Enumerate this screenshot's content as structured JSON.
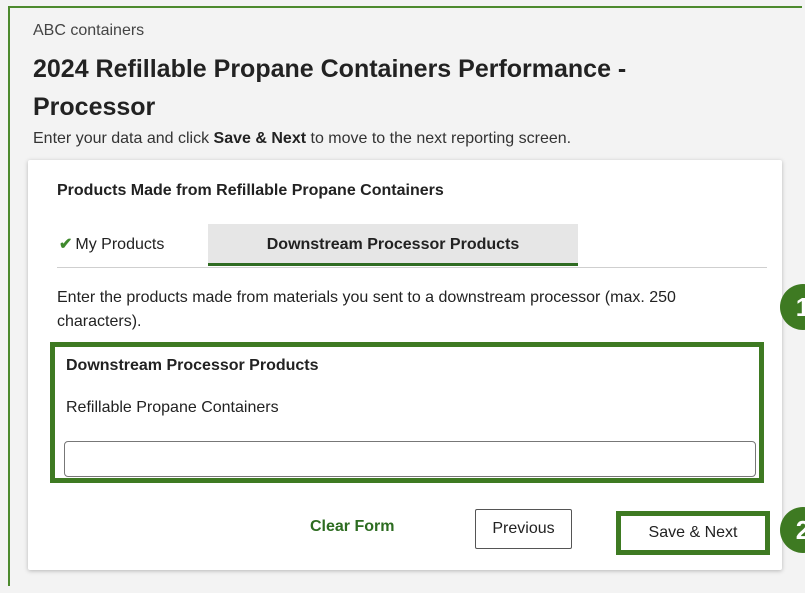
{
  "header": {
    "organization": "ABC containers",
    "title": "2024 Refillable Propane Containers Performance - Processor",
    "instruction_prefix": "Enter your data and click ",
    "instruction_bold": "Save & Next",
    "instruction_suffix": " to move to the next reporting screen."
  },
  "card": {
    "section_title": "Products Made from Refillable Propane Containers",
    "tabs": [
      {
        "label": "My Products",
        "completed": true
      },
      {
        "label": "Downstream Processor Products",
        "active": true
      }
    ],
    "instructions": "Enter the products made from materials you sent to a downstream processor (max. 250 characters).",
    "field": {
      "heading": "Downstream Processor Products",
      "label": "Refillable Propane Containers",
      "value": ""
    },
    "buttons": {
      "clear": "Clear Form",
      "previous": "Previous",
      "save_next": "Save & Next"
    }
  },
  "markers": {
    "one": "1",
    "two": "2"
  },
  "colors": {
    "accent_green": "#3e7a22",
    "text": "#222222",
    "background": "#f3f3f3"
  }
}
